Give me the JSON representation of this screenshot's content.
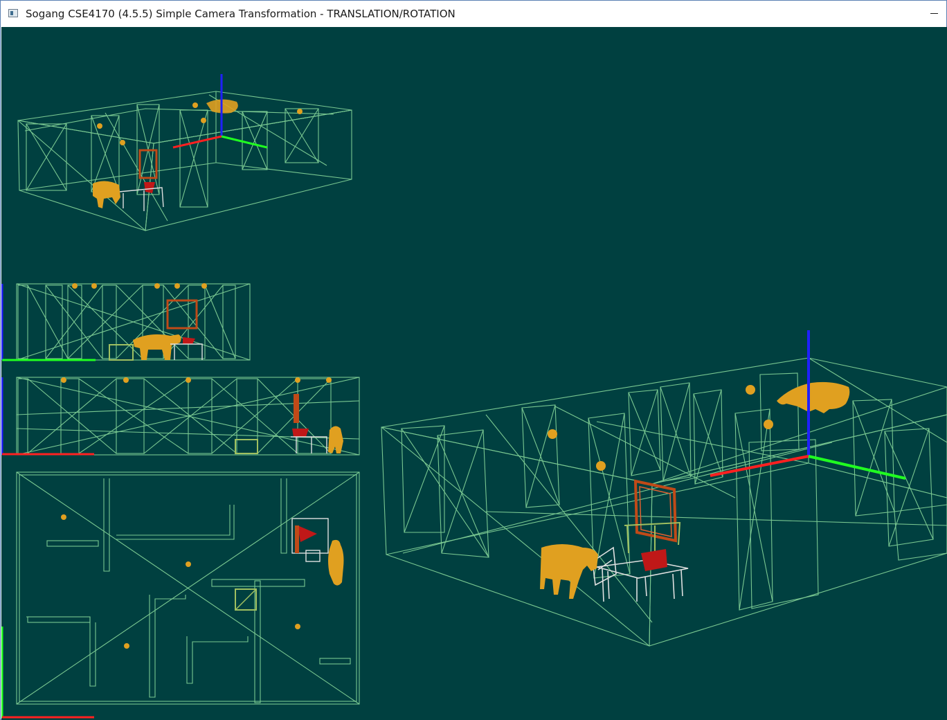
{
  "window": {
    "title": "Sogang CSE4170 (4.5.5) Simple Camera Transformation - TRANSLATION/ROTATION"
  },
  "colors": {
    "background": "#004040",
    "wireframe": "#90e0a0",
    "axis_x": "#ff2020",
    "axis_y": "#20ff20",
    "axis_z": "#2020ff",
    "object_gold": "#e0a020",
    "object_red": "#c01818",
    "object_white": "#e0e0e0",
    "frame_orange": "#c04a18"
  },
  "viewports": [
    {
      "name": "perspective-small"
    },
    {
      "name": "front-ortho"
    },
    {
      "name": "side-ortho"
    },
    {
      "name": "top-ortho"
    },
    {
      "name": "perspective-main"
    }
  ]
}
